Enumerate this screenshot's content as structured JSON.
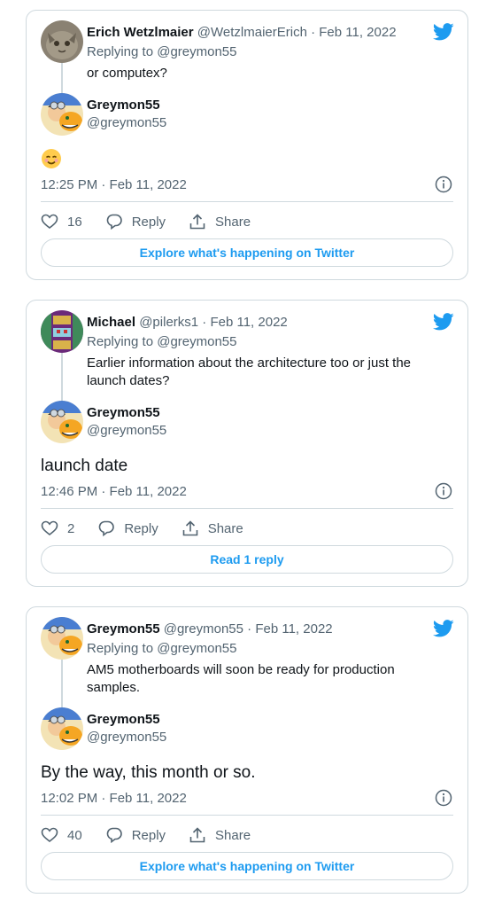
{
  "colors": {
    "accent": "#1d9bf0",
    "muted": "#536471",
    "border": "#cfd9de"
  },
  "icons": {
    "logo": "twitter-bird-icon",
    "info": "info-icon",
    "like": "heart-icon",
    "reply": "reply-bubble-icon",
    "share": "share-icon"
  },
  "tweets": [
    {
      "parent": {
        "name": "Erich Wetzlmaier",
        "handle": "@WetzlmaierErich",
        "date": "· Feb 11, 2022",
        "replying_label": "Replying to",
        "replying_handle": "@greymon55",
        "text": "or computex?"
      },
      "main": {
        "name": "Greymon55",
        "handle": "@greymon55",
        "text": "😊",
        "timestamp": "12:25 PM · Feb 11, 2022",
        "likes": "16",
        "reply_label": "Reply",
        "share_label": "Share",
        "cta": "Explore what's happening on Twitter"
      }
    },
    {
      "parent": {
        "name": "Michael",
        "handle": "@pilerks1",
        "date": "· Feb 11, 2022",
        "replying_label": "Replying to",
        "replying_handle": "@greymon55",
        "text": "Earlier information about the architecture too or just the launch dates?"
      },
      "main": {
        "name": "Greymon55",
        "handle": "@greymon55",
        "text": "launch date",
        "timestamp": "12:46 PM · Feb 11, 2022",
        "likes": "2",
        "reply_label": "Reply",
        "share_label": "Share",
        "cta": "Read 1 reply"
      }
    },
    {
      "parent": {
        "name": "Greymon55",
        "handle": "@greymon55",
        "date": "· Feb 11, 2022",
        "replying_label": "Replying to",
        "replying_handle": "@greymon55",
        "text": "AM5 motherboards will soon be ready for production samples."
      },
      "main": {
        "name": "Greymon55",
        "handle": "@greymon55",
        "text": "By the way, this month or so.",
        "timestamp": "12:02 PM · Feb 11, 2022",
        "likes": "40",
        "reply_label": "Reply",
        "share_label": "Share",
        "cta": "Explore what's happening on Twitter"
      }
    }
  ]
}
